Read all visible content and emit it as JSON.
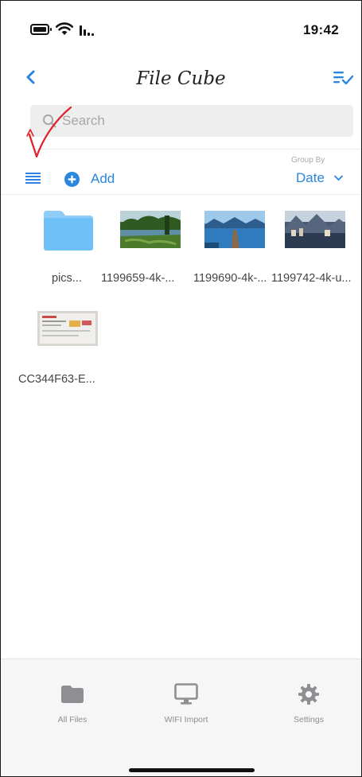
{
  "status_bar": {
    "time": "19:42"
  },
  "nav": {
    "title": "File Cube"
  },
  "search": {
    "placeholder": "Search"
  },
  "toolbar": {
    "add_label": "Add",
    "group_by_label": "Group By",
    "group_by_value": "Date"
  },
  "files": [
    {
      "name": "pics...",
      "type": "folder",
      "icon": "folder-icon"
    },
    {
      "name": "1199659-4k-...",
      "type": "image",
      "icon": "forest-lake-thumbnail"
    },
    {
      "name": "1199690-4k-...",
      "type": "image",
      "icon": "lake-pier-thumbnail"
    },
    {
      "name": "1199742-4k-u...",
      "type": "image",
      "icon": "mountain-town-thumbnail"
    },
    {
      "name": "CC344F63-E...",
      "type": "image",
      "icon": "screenshot-thumbnail"
    }
  ],
  "tab_bar": {
    "tabs": [
      {
        "label": "All Files",
        "icon": "folder-icon"
      },
      {
        "label": "WIFI Import",
        "icon": "monitor-icon"
      },
      {
        "label": "Settings",
        "icon": "gear-icon"
      }
    ]
  },
  "colors": {
    "accent": "#2a86df",
    "folder": "#6fc0f7",
    "annotation": "#e0202a",
    "tab_icon": "#8e8e93"
  }
}
